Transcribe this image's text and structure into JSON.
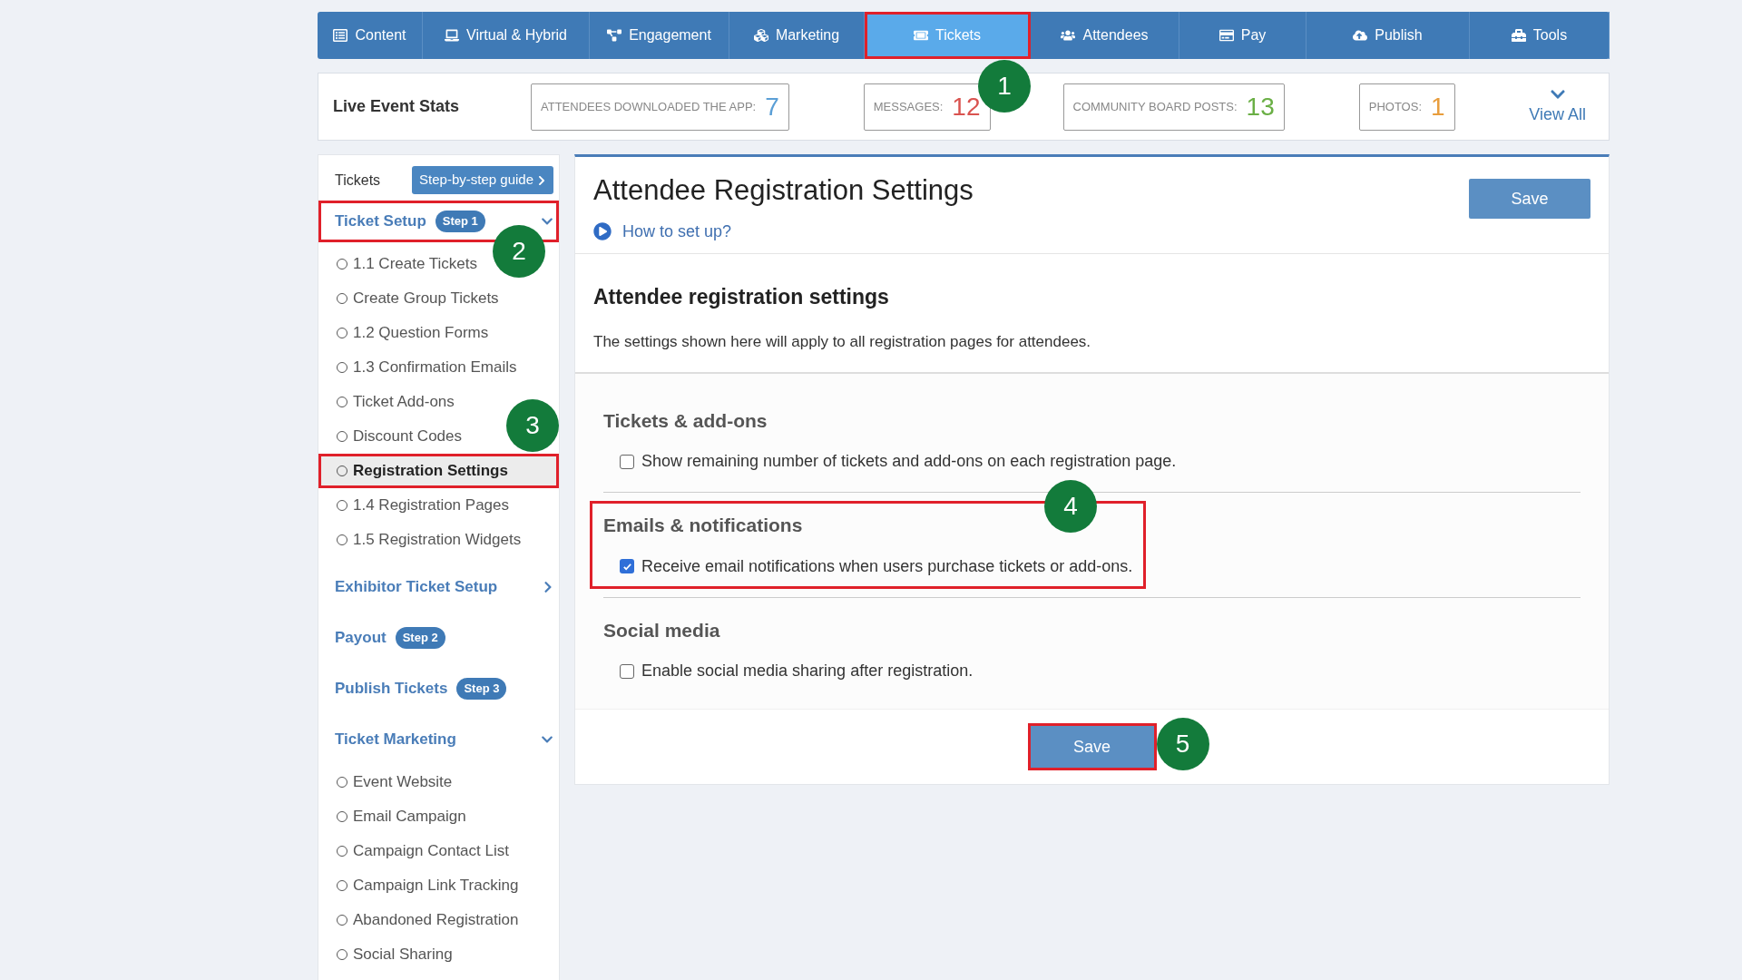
{
  "nav_tabs": [
    {
      "label": "Content",
      "selected": false
    },
    {
      "label": "Virtual & Hybrid",
      "selected": false
    },
    {
      "label": "Engagement",
      "selected": false
    },
    {
      "label": "Marketing",
      "selected": false
    },
    {
      "label": "Tickets",
      "selected": true,
      "highlighted": true,
      "callout": "1"
    },
    {
      "label": "Attendees",
      "selected": false
    },
    {
      "label": "Pay",
      "selected": false
    },
    {
      "label": "Publish",
      "selected": false
    },
    {
      "label": "Tools",
      "selected": false
    }
  ],
  "stats": {
    "title": "Live Event Stats",
    "items": [
      {
        "label": "ATTENDEES DOWNLOADED THE APP:",
        "value": "7",
        "color": "#5b9fd6"
      },
      {
        "label": "MESSAGES:",
        "value": "12",
        "color": "#d9534f"
      },
      {
        "label": "COMMUNITY BOARD POSTS:",
        "value": "13",
        "color": "#6aaf45"
      },
      {
        "label": "PHOTOS:",
        "value": "1",
        "color": "#e89d3c"
      }
    ],
    "view_all": "View All"
  },
  "sidebar": {
    "title": "Tickets",
    "guide_button": "Step-by-step guide",
    "groups": [
      {
        "title": "Ticket Setup",
        "badge": "Step 1",
        "expanded": true,
        "highlighted": true,
        "callout": "2",
        "children": [
          {
            "label": "1.1 Create Tickets",
            "selected": false
          },
          {
            "label": "Create Group Tickets",
            "selected": false
          },
          {
            "label": "1.2 Question Forms",
            "selected": false
          },
          {
            "label": "1.3 Confirmation Emails",
            "selected": false
          },
          {
            "label": "Ticket Add-ons",
            "selected": false
          },
          {
            "label": "Discount Codes",
            "selected": false
          },
          {
            "label": "Registration Settings",
            "selected": true,
            "highlighted": true,
            "callout": "3"
          },
          {
            "label": "1.4 Registration Pages",
            "selected": false
          },
          {
            "label": "1.5 Registration Widgets",
            "selected": false
          }
        ]
      },
      {
        "title": "Exhibitor Ticket Setup",
        "expanded": false
      },
      {
        "title": "Payout",
        "badge": "Step 2"
      },
      {
        "title": "Publish Tickets",
        "badge": "Step 3"
      },
      {
        "title": "Ticket Marketing",
        "expanded": true,
        "children": [
          {
            "label": "Event Website",
            "selected": false
          },
          {
            "label": "Email Campaign",
            "selected": false
          },
          {
            "label": "Campaign Contact List",
            "selected": false
          },
          {
            "label": "Campaign Link Tracking",
            "selected": false
          },
          {
            "label": "Abandoned Registration",
            "selected": false
          },
          {
            "label": "Social Sharing",
            "selected": false
          }
        ]
      }
    ]
  },
  "main": {
    "title": "Attendee Registration Settings",
    "help_link": "How to set up?",
    "save_top": "Save",
    "heading": "Attendee registration settings",
    "description": "The settings shown here will apply to all registration pages for attendees.",
    "sections": [
      {
        "title": "Tickets & add-ons",
        "option": "Show remaining number of tickets and add-ons on each registration page.",
        "checked": false
      },
      {
        "title": "Emails & notifications",
        "option": "Receive email notifications when users purchase tickets or add-ons.",
        "checked": true,
        "highlighted": true,
        "callout": "4"
      },
      {
        "title": "Social media",
        "option": "Enable social media sharing after registration.",
        "checked": false
      }
    ],
    "save_bottom": {
      "label": "Save",
      "highlighted": true,
      "callout": "5"
    }
  }
}
